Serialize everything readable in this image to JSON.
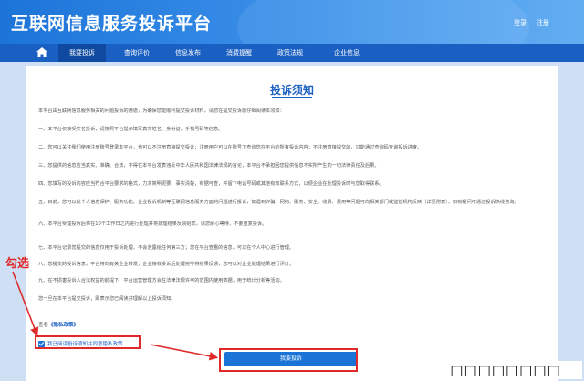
{
  "header": {
    "site_title": "互联网信息服务投诉平台",
    "login": "登录",
    "register": "注册"
  },
  "nav": {
    "home_icon": "home-icon",
    "items": [
      {
        "label": "我要投诉",
        "active": true
      },
      {
        "label": "查询评价"
      },
      {
        "label": "信息发布"
      },
      {
        "label": "消费提醒"
      },
      {
        "label": "政策法规"
      },
      {
        "label": "企业信息"
      }
    ]
  },
  "notice": {
    "title": "投诉须知",
    "paragraphs": [
      "本平台由互联网信息服务相关的问题投诉的通道，为确保您能顺利提交投诉材料，请您在提交投诉前仔细阅读本须知：",
      "一、本平台仅接受实名投诉，请按照平台提示填写真实姓名、身份证、手机号码等信息。",
      "二、您可以关注我们使用注册账号登录本平台，也可以不注册直接提交投诉；注册用户可以在账号下查询您在平台的所有投诉内容；不注册直接提交的，只能通过查询码查询投诉进度。",
      "三、您提供的信息应当真实、准确、合法，不得在本平台发表违反中华人民共和国法律法规的言论，本平台不承担因您提供信息不实所产生的一切法律责任及后果。",
      "四、您填写的投诉内容应当符合平台要求的格式，力求简明扼要、事实清楚，有据可查，并留下电话号码或其他有效联系方式，以便企业在处理投诉时与您取得联系。",
      "五、目前，您可以就个人信息保护、服务功能、企业投诉机制等互联网信息服务方面的问题进行投诉，如遇到诈骗、网络、服务、安全、收费、费用等问题可向相关部门或监管机构反映（详见附表），如有疑问可通过投诉热线咨询。",
      "六、本平台受理投诉后将在10个工作日之内进行处理并将处理结果反馈给您，请您耐心等待，不要重复投诉。",
      "七、本平台记录您提交的信息仅用于投诉处理，不会泄露给任何第三方；您在平台查看的信息，可以在个人中心进行管理。",
      "八、您提交的投诉信息，平台将向有关企业转发，企业接收投诉后处理完毕将结果反馈，您可以对企业处理结果进行评价。",
      "九、在不损害投诉人合法权益的前提下，平台运营管理方会在法律法规许可的范围内使用数据，用于统计分析等活动。",
      "您一旦在本平台提交投诉，即表示您已阅读并理解以上投诉须知。"
    ],
    "privacy_prefix": "查看",
    "privacy_link": "《隐私政策》",
    "agree_label": "我已阅读投诉须知并同意隐私政策",
    "submit_label": "我要投诉"
  },
  "annotation": {
    "label": "勾选",
    "color": "#e02a2a"
  },
  "watermark": "□□□□□□□□",
  "colors": {
    "brand": "#1a5fc2",
    "accent": "#1a74d8",
    "annotation": "#e02a2a"
  }
}
